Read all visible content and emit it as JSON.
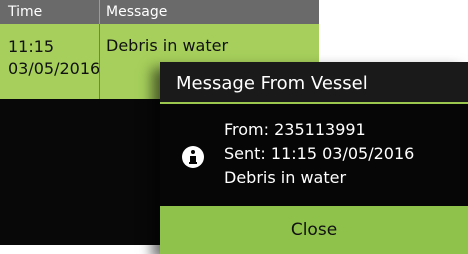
{
  "log": {
    "headers": {
      "time": "Time",
      "message": "Message"
    },
    "rows": [
      {
        "time_line1": "11:15",
        "time_line2": "03/05/2016",
        "message": "Debris in water"
      }
    ]
  },
  "dialog": {
    "title": "Message From Vessel",
    "icon": "info-icon",
    "from": "From: 235113991",
    "sent": "Sent: 11:15 03/05/2016",
    "message": "Debris in water",
    "close_label": "Close"
  },
  "colors": {
    "accent_green": "#8fc24b",
    "row_green": "#a6cf5b",
    "header_gray": "#6a6a6a",
    "background": "#080808"
  }
}
